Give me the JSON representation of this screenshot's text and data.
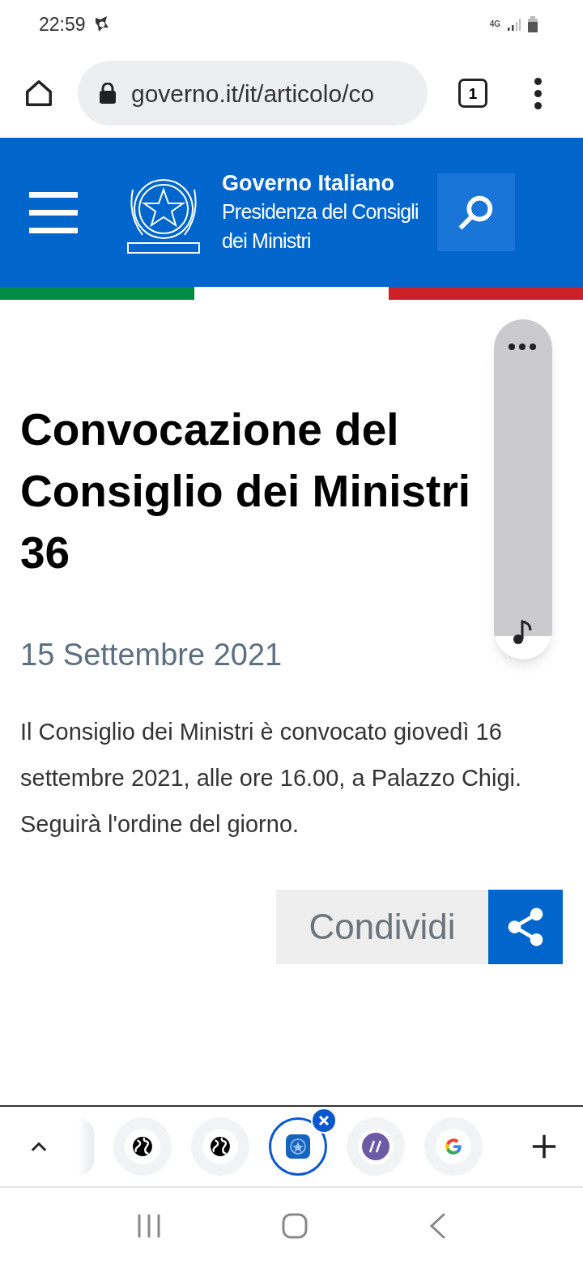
{
  "status_bar": {
    "time": "22:59",
    "network": "4G"
  },
  "browser": {
    "url": "governo.it/it/articolo/co",
    "tab_count": "1"
  },
  "site_header": {
    "name": "Governo Italiano",
    "subtitle_lines": [
      "Presidenza del Consigli",
      "dei Ministri"
    ]
  },
  "article": {
    "title_lines": [
      "Convocazione del",
      "Consiglio dei Ministri",
      "36"
    ],
    "date": "15 Settembre 2021",
    "body": "Il Consiglio dei Ministri è convocato giovedì 16 settembre 2021, alle ore 16.00, a Palazzo Chigi. Seguirà l'ordine del giorno.",
    "share_label": "Condividi"
  },
  "volume": {
    "level": 0.07
  },
  "tabs": [
    {
      "kind": "faded",
      "selected": false
    },
    {
      "kind": "globe",
      "selected": false
    },
    {
      "kind": "globe",
      "selected": false
    },
    {
      "kind": "emblem",
      "selected": true
    },
    {
      "kind": "slashes",
      "selected": false
    },
    {
      "kind": "google",
      "selected": false
    }
  ]
}
